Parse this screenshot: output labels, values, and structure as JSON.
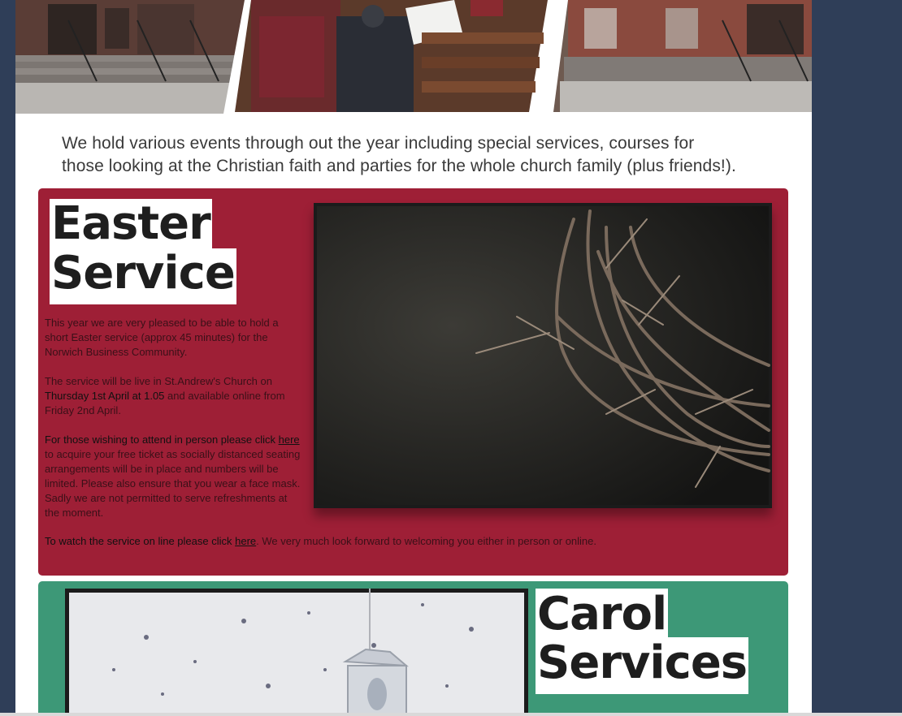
{
  "intro": {
    "line1": "We hold various events through out the year including special services, courses for",
    "line2": "those looking at the Christian faith and parties for the whole church family (plus friends!)."
  },
  "easter": {
    "title_line1": "Easter",
    "title_line2": "Service",
    "p1": "This year we are very pleased to be able to hold a short Easter service (approx 45 minutes) for the Norwich Business Community.",
    "p2_a": "The service will be live in St.Andrew's Church on ",
    "p2_b": "Thursday 1st April at 1.05",
    "p2_c": " and available online from Friday 2nd April.",
    "p3_a": "For those wishing to attend  in person please click ",
    "p3_link": "here",
    "p3_b": " to acquire your free ticket as socially distanced seating arrangements will be in place and numbers will be limited.  Please also ensure that you wear a face mask.  Sadly we are not permitted to serve refreshments at the moment.",
    "watch_a": "To watch the service on line please click ",
    "watch_link": "here",
    "watch_b": ". We very much look forward to welcoming you either in person or online."
  },
  "carol": {
    "title_line1": "Carol",
    "title_line2": "Services"
  },
  "colors": {
    "page_bg": "#2f3e58",
    "easter_panel": "#9e1f36",
    "carol_panel": "#3d9877",
    "title_text": "#1e1e1e"
  }
}
